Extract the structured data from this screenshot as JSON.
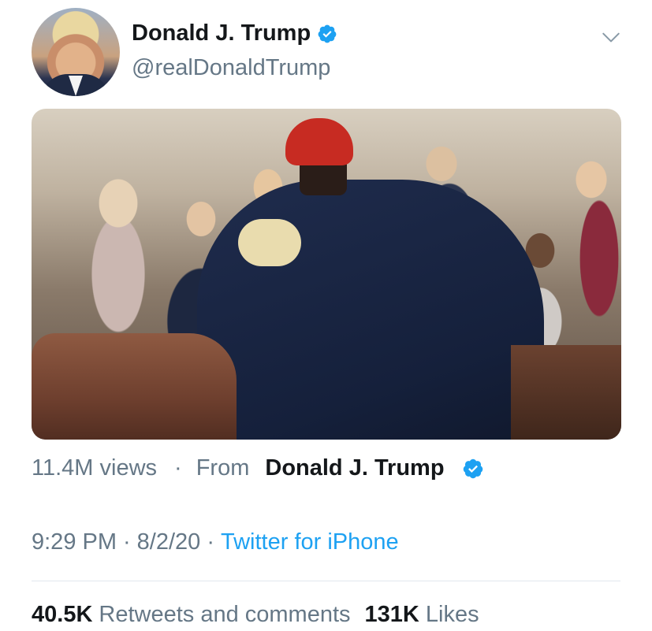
{
  "tweet": {
    "author": {
      "display_name": "Donald J. Trump",
      "handle": "@realDonaldTrump",
      "verified": true
    },
    "media": {
      "type": "video"
    },
    "meta": {
      "views": "11.4M views",
      "separator": "·",
      "from_label": "From",
      "from_name": "Donald J. Trump"
    },
    "timestamp": {
      "time": "9:29 PM",
      "sep1": "·",
      "date": "8/2/20",
      "sep2": "·",
      "source": "Twitter for iPhone"
    },
    "stats": {
      "retweets_count": "40.5K",
      "retweets_label": "Retweets and comments",
      "likes_count": "131K",
      "likes_label": "Likes"
    }
  },
  "colors": {
    "accent": "#1da1f2",
    "text_primary": "#14171a",
    "text_secondary": "#657786",
    "divider": "#e1e8ed"
  },
  "icons": {
    "verified": "verified-badge-icon",
    "menu": "chevron-down-icon"
  }
}
